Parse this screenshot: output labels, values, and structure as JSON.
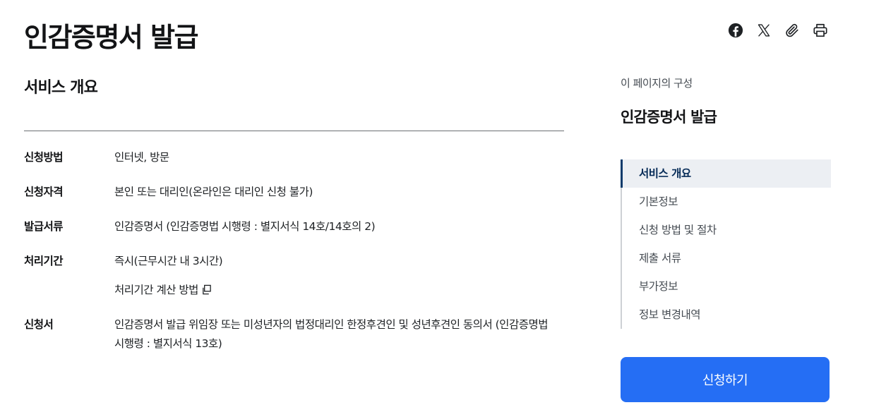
{
  "page": {
    "title": "인감증명서 발급"
  },
  "share": {
    "icons": [
      "facebook-icon",
      "x-icon",
      "paperclip-icon",
      "print-icon"
    ]
  },
  "overview": {
    "title": "서비스 개요",
    "rows": [
      {
        "label": "신청방법",
        "value": "인터넷, 방문"
      },
      {
        "label": "신청자격",
        "value": "본인 또는 대리인(온라인은 대리인 신청 불가)"
      },
      {
        "label": "발급서류",
        "value": "인감증명서 (인감증명법 시행령 : 별지서식 14호/14호의 2)"
      },
      {
        "label": "처리기간",
        "value": "즉시(근무시간 내 3시간)",
        "link": "처리기간 계산 방법"
      },
      {
        "label": "신청서",
        "value": "인감증명서 발급 위임장 또는 미성년자의 법정대리인 한정후견인 및 성년후견인 동의서 (인감증명법 시행령 : 별지서식 13호)"
      }
    ]
  },
  "toc": {
    "caption": "이 페이지의 구성",
    "title": "인감증명서 발급",
    "items": [
      "서비스 개요",
      "기본정보",
      "신청 방법 및 절차",
      "제출 서류",
      "부가정보",
      "정보 변경내역"
    ],
    "active_index": 0
  },
  "apply_button": {
    "label": "신청하기"
  },
  "colors": {
    "primary": "#256ef4",
    "active_bar": "#0b3b6b",
    "active_bg": "#eceff3",
    "text": "#1e2124"
  }
}
